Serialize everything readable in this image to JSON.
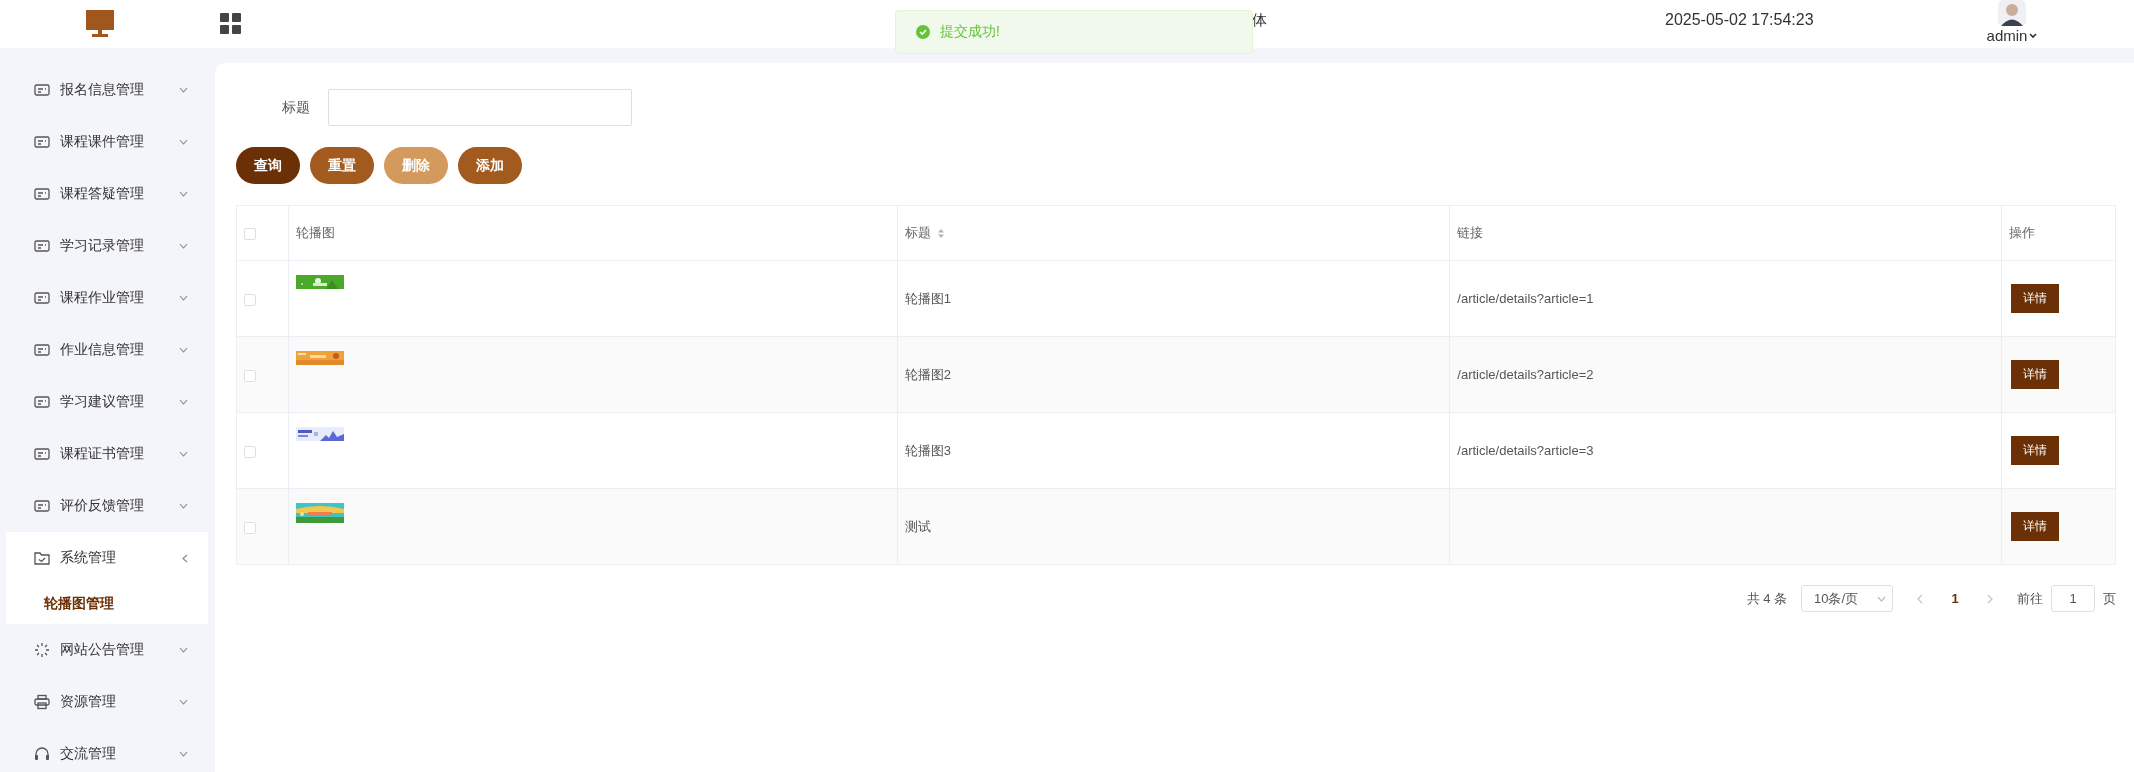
{
  "header": {
    "title_fragment": "体",
    "datetime": "2025-05-02 17:54:23",
    "user": "admin"
  },
  "toast": {
    "message": "提交成功!"
  },
  "sidebar": {
    "items": [
      {
        "label": "报名信息管理",
        "kind": "card",
        "expanded": false
      },
      {
        "label": "课程课件管理",
        "kind": "card",
        "expanded": false
      },
      {
        "label": "课程答疑管理",
        "kind": "card",
        "expanded": false
      },
      {
        "label": "学习记录管理",
        "kind": "card",
        "expanded": false
      },
      {
        "label": "课程作业管理",
        "kind": "card",
        "expanded": false
      },
      {
        "label": "作业信息管理",
        "kind": "card",
        "expanded": false
      },
      {
        "label": "学习建议管理",
        "kind": "card",
        "expanded": false
      },
      {
        "label": "课程证书管理",
        "kind": "card",
        "expanded": false
      },
      {
        "label": "评价反馈管理",
        "kind": "card",
        "expanded": false
      },
      {
        "label": "系统管理",
        "kind": "folder",
        "expanded": true,
        "children": [
          {
            "label": "轮播图管理",
            "selected": true
          }
        ]
      },
      {
        "label": "网站公告管理",
        "kind": "sparkle",
        "expanded": false
      },
      {
        "label": "资源管理",
        "kind": "printer",
        "expanded": false
      },
      {
        "label": "交流管理",
        "kind": "headset",
        "expanded": false
      }
    ]
  },
  "search": {
    "label": "标题"
  },
  "buttons": [
    {
      "label": "查询",
      "color": "#6b3005"
    },
    {
      "label": "重置",
      "color": "#a35a1f"
    },
    {
      "label": "删除",
      "color": "#d4995c"
    },
    {
      "label": "添加",
      "color": "#a35a1f"
    }
  ],
  "table": {
    "all_selected": false,
    "columns": [
      "轮播图",
      "标题",
      "链接",
      "操作"
    ],
    "rows": [
      {
        "selected": false,
        "title": "轮播图1",
        "link": "/article/details?article=1",
        "action": "详情"
      },
      {
        "selected": false,
        "title": "轮播图2",
        "link": "/article/details?article=2",
        "action": "详情"
      },
      {
        "selected": false,
        "title": "轮播图3",
        "link": "/article/details?article=3",
        "action": "详情"
      },
      {
        "selected": false,
        "title": "测试",
        "action": "详情"
      }
    ]
  },
  "pagination": {
    "total": "共 4 条",
    "page_size": "10条/页",
    "pages": [
      {
        "label": "1",
        "selected": true
      }
    ],
    "goto_label": "前往",
    "goto_value": "1",
    "page_suffix": "页"
  }
}
